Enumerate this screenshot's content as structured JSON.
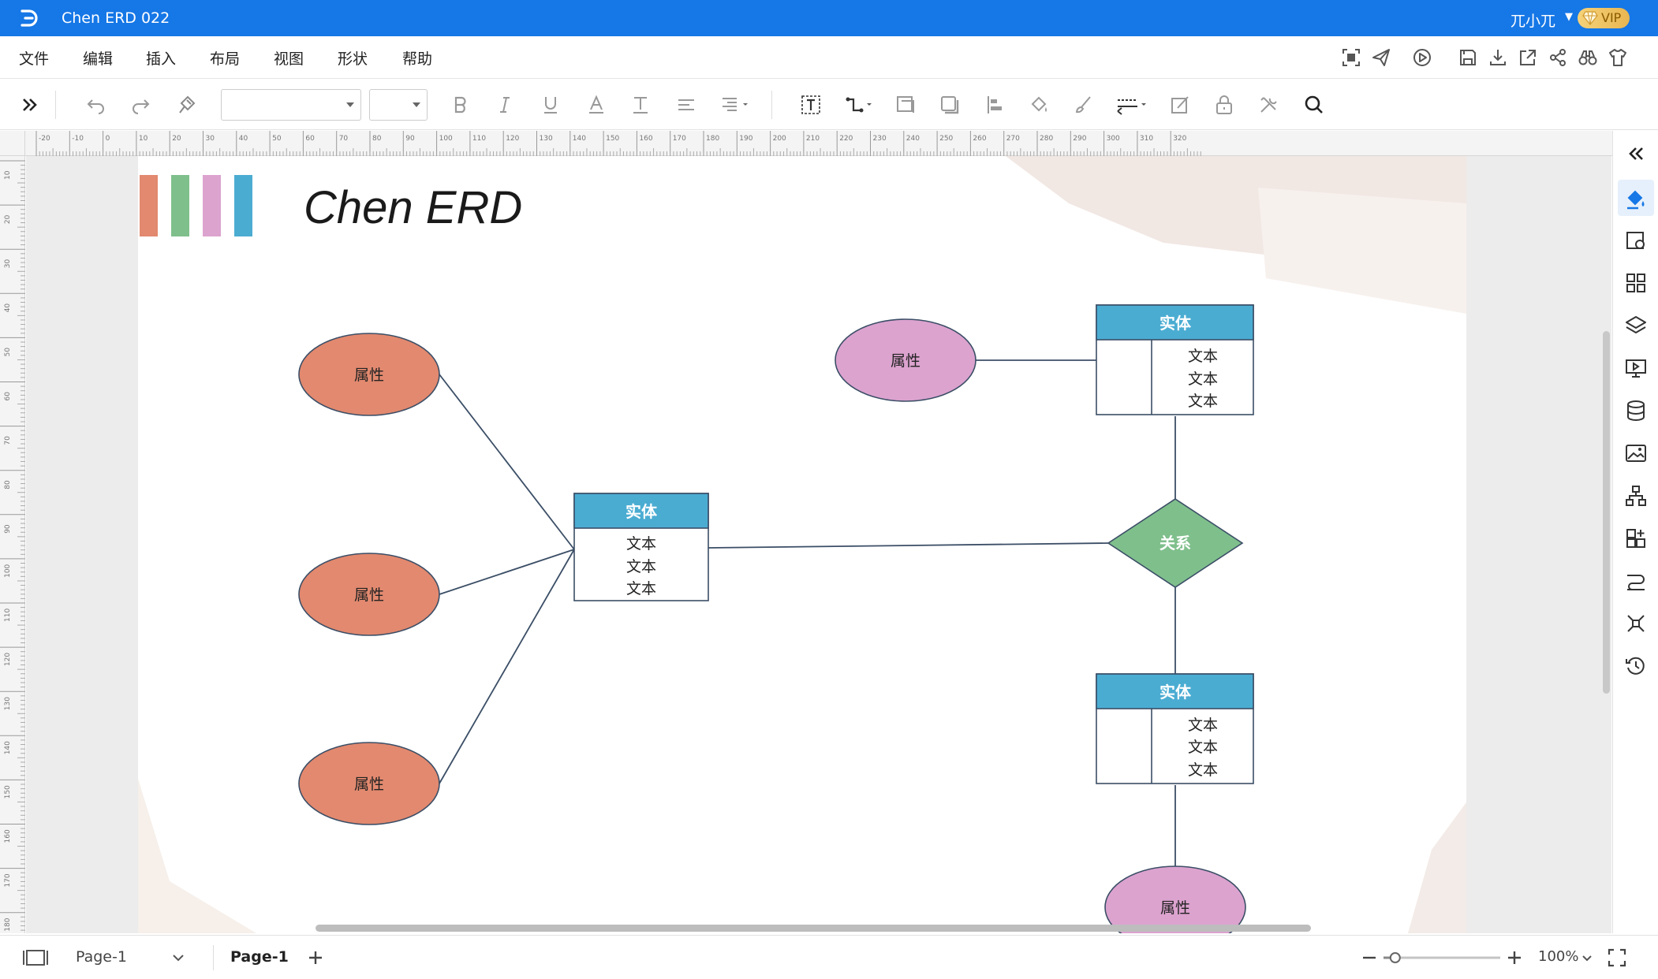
{
  "app": {
    "document_title": "Chen ERD 022",
    "user_name": "兀小兀",
    "vip_label": "VIP"
  },
  "menu": {
    "items": [
      "文件",
      "编辑",
      "插入",
      "布局",
      "视图",
      "形状",
      "帮助"
    ]
  },
  "ruler": {
    "top_labels": [
      "-20",
      "-10",
      "0",
      "10",
      "20",
      "30",
      "40",
      "50",
      "60",
      "70",
      "80",
      "90",
      "100",
      "110",
      "120",
      "130",
      "140",
      "150",
      "160",
      "170",
      "180",
      "190",
      "200",
      "210",
      "220",
      "230",
      "240",
      "250",
      "260",
      "270",
      "280",
      "290",
      "300",
      "310",
      "320"
    ],
    "left_labels": [
      "10",
      "20",
      "30",
      "40",
      "50",
      "60",
      "70",
      "80",
      "90",
      "100",
      "110",
      "120",
      "130",
      "140",
      "150",
      "160",
      "170",
      "180"
    ]
  },
  "diagram": {
    "title": "Chen ERD",
    "colors": {
      "attribute_orange": "#e2896f",
      "attribute_pink": "#dca3cf",
      "relationship_green": "#7fbf8c",
      "entity_header_blue": "#4bacd2",
      "swatch_blue": "#4bacd2",
      "line": "#3b4e66"
    },
    "attribute_label": "属性",
    "entity_label": "实体",
    "relationship_label": "关系",
    "row_label": "文本"
  },
  "status": {
    "page_selector": "Page-1",
    "active_tab": "Page-1",
    "zoom": "100%",
    "zoom_level": 0.1
  }
}
